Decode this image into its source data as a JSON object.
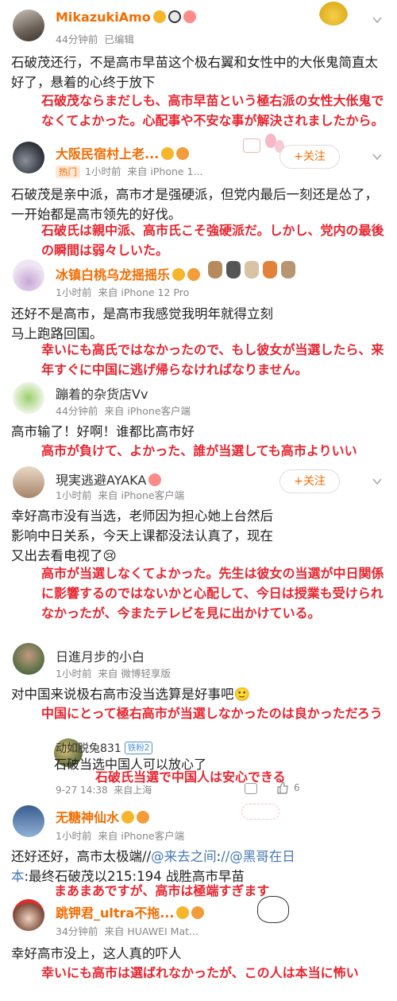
{
  "posts": [
    {
      "name": "MikazukiAmo",
      "time": "44分钟前",
      "edited": "已编辑",
      "text": "石破茂还行，不是高市早苗这个极右翼和女性中的大伥鬼简直太好了，悬着的心终于放下",
      "jp": "石破茂ならまだしも、高市早苗という極右派の女性大伥鬼でなくてよかった。心配事や不安な事が解決されましたから。"
    },
    {
      "name": "大阪民宿村上老...",
      "hot": "热门",
      "time": "1小时前",
      "from": "来自 iPhone 1...",
      "follow": "+关注",
      "text": "石破茂是亲中派，高市才是强硬派，但党内最后一刻还是怂了，一开始都是高市领先的好伐。",
      "jp": "石破氏は親中派、高市氏こそ強硬派だ。しかし、党内の最後の瞬間は弱々しいた。"
    },
    {
      "name": "冰镇白桃乌龙摇摇乐",
      "time": "1小时前",
      "from": "来自 iPhone 12 Pro",
      "text": "还好不是高市，是高市我感觉我明年就得立刻马上跑路回国。",
      "jp": "幸いにも高氏ではなかったので、もし彼女が当選したら、来年すぐに中国に逃げ帰らなければなりません。"
    },
    {
      "name": "蹦着的杂货店Vv",
      "time": "44分钟前",
      "from": "来自 iPhone客户端",
      "text": "高市输了！好啊！谁都比高市好",
      "jp": "高市が負けて、よかった、誰が当選しても高市よりいい"
    },
    {
      "name": "現実逃避AYAKA",
      "time": "1小时前",
      "from": "来自 iPhone客户端",
      "follow": "+关注",
      "text": "幸好高市没有当选，老师因为担心她上台然后影响中日关系，今天上课都没法认真了，现在又出去看电视了😢",
      "jp": "高市が当選しなくてよかった。先生は彼女の当選が中日関係に影響するのではないかと心配して、今日は授業も受けられなかったが、今またテレビを見に出かけている。"
    },
    {
      "name": "日進月步的小白",
      "time": "1小时前",
      "from": "来自 微博轻享版",
      "text": "对中国来说极右高市没当选算是好事吧🙂",
      "jp": "中国にとって極右高市が当選しなかったのは良かっただろう"
    },
    {
      "name": "动如脱兔831",
      "fans_tag": "铁粉2",
      "time": "9-27 14:38",
      "from": "来自上海",
      "likes": "6",
      "text": "石破当选中国人可以放心了",
      "jp": "石破氏当選で中国人は安心できる"
    },
    {
      "name": "无糖神仙水",
      "time": "1小时前",
      "from": "来自 iPhone客户端",
      "text_pre": "还好还好，高市太极端//",
      "link1": "@来去之间",
      "text_mid": ":",
      "link2": "//@黑哥在日本",
      "text_post": ":最终石破茂以215:194 战胜高市早苗",
      "jp": "まあまあですが、高市は極端すぎます"
    },
    {
      "name": "跳钾君_ultra不拖...",
      "time": "34分钟前",
      "from": "来自 HUAWEI Mat...",
      "text": "幸好高市没上，这人真的吓人",
      "jp": "幸いにも高市は選ばれなかったが、この人は本当に怖い"
    }
  ],
  "colors": {
    "username": "#f46c00",
    "annotation": "#e8252f",
    "link": "#4678b4"
  }
}
